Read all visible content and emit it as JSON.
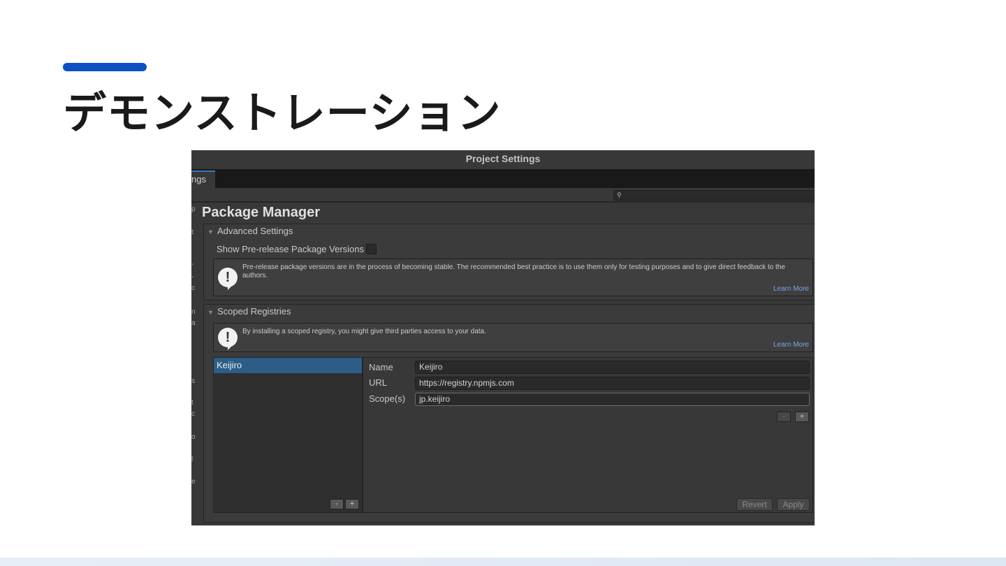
{
  "slide": {
    "title": "デモンストレーション",
    "accent_color": "#0a52c2"
  },
  "window": {
    "title": "Project Settings",
    "tab_label": "ngs",
    "search_placeholder": "",
    "left_nav_fragments": [
      "p",
      "t",
      "-",
      "-",
      "c",
      "n",
      "a",
      "s",
      "t",
      "c",
      "o",
      "l",
      "e"
    ]
  },
  "package_manager": {
    "title": "Package Manager",
    "advanced": {
      "header": "Advanced Settings",
      "prerelease_label": "Show Pre-release Package Versions",
      "prerelease_checked": false,
      "help_text": "Pre-release package versions are in the process of becoming stable. The recommended best practice is to use them only for testing purposes and to give direct feedback to the authors.",
      "learn_more": "Learn More"
    },
    "scoped": {
      "header": "Scoped Registries",
      "help_text": "By installing a scoped registry, you might give third parties access to your data.",
      "learn_more": "Learn More",
      "registries": [
        {
          "name": "Keijiro",
          "selected": true
        }
      ],
      "list_remove": "-",
      "list_add": "+",
      "name_label": "Name",
      "name_value": "Keijiro",
      "url_label": "URL",
      "url_value": "https://registry.npmjs.com",
      "scopes_label": "Scope(s)",
      "scopes_value": "jp.keijiro",
      "scope_remove": "-",
      "scope_add": "+",
      "revert": "Revert",
      "apply": "Apply"
    }
  },
  "colors": {
    "selection": "#2c5d87",
    "link": "#7ba4e6",
    "tab_underline": "#3a79bb"
  }
}
